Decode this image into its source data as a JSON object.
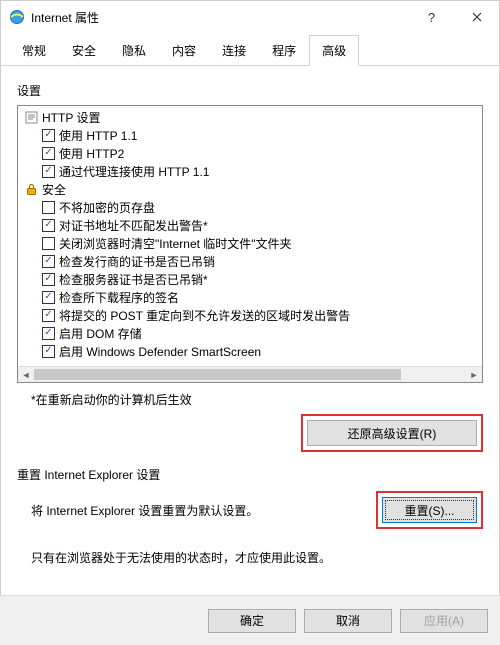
{
  "window": {
    "title": "Internet 属性",
    "help": "?",
    "close": "×"
  },
  "tabs": {
    "items": [
      {
        "label": "常规"
      },
      {
        "label": "安全"
      },
      {
        "label": "隐私"
      },
      {
        "label": "内容"
      },
      {
        "label": "连接"
      },
      {
        "label": "程序"
      },
      {
        "label": "高级"
      }
    ],
    "active_index": 6
  },
  "settings": {
    "label": "设置",
    "tree": [
      {
        "type": "cat",
        "icon": "page-icon",
        "label": "HTTP 设置"
      },
      {
        "type": "chk",
        "checked": true,
        "label": "使用 HTTP 1.1"
      },
      {
        "type": "chk",
        "checked": true,
        "label": "使用 HTTP2"
      },
      {
        "type": "chk",
        "checked": true,
        "label": "通过代理连接使用 HTTP 1.1"
      },
      {
        "type": "cat",
        "icon": "lock-icon",
        "label": "安全"
      },
      {
        "type": "chk",
        "checked": false,
        "label": "不将加密的页存盘"
      },
      {
        "type": "chk",
        "checked": true,
        "label": "对证书地址不匹配发出警告*"
      },
      {
        "type": "chk",
        "checked": false,
        "label": "关闭浏览器时清空\"Internet 临时文件\"文件夹"
      },
      {
        "type": "chk",
        "checked": true,
        "label": "检查发行商的证书是否已吊销"
      },
      {
        "type": "chk",
        "checked": true,
        "label": "检查服务器证书是否已吊销*"
      },
      {
        "type": "chk",
        "checked": true,
        "label": "检查所下载程序的签名"
      },
      {
        "type": "chk",
        "checked": true,
        "label": "将提交的 POST 重定向到不允许发送的区域时发出警告"
      },
      {
        "type": "chk",
        "checked": true,
        "label": "启用 DOM 存储"
      },
      {
        "type": "chk",
        "checked": true,
        "label": "启用 Windows Defender SmartScreen"
      }
    ],
    "note": "*在重新启动你的计算机后生效",
    "restore_btn": "还原高级设置(R)"
  },
  "reset": {
    "title": "重置 Internet Explorer 设置",
    "desc": "将 Internet Explorer 设置重置为默认设置。",
    "btn": "重置(S)...",
    "hint": "只有在浏览器处于无法使用的状态时，才应使用此设置。"
  },
  "footer": {
    "ok": "确定",
    "cancel": "取消",
    "apply": "应用(A)"
  }
}
